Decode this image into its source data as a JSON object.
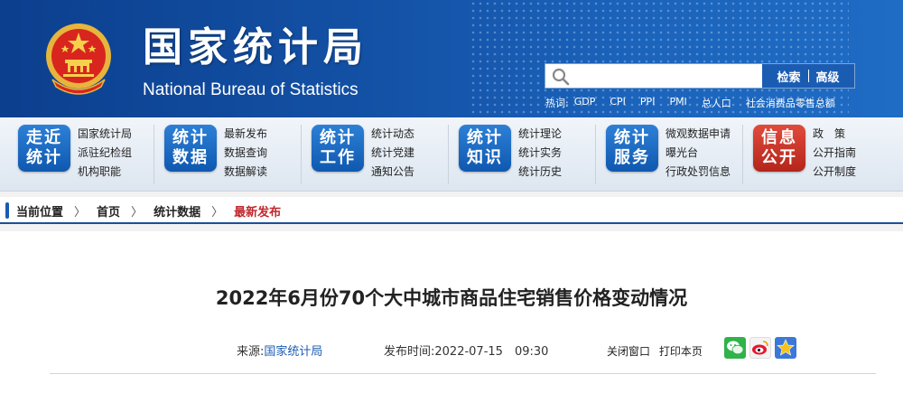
{
  "header": {
    "title_cn": "国家统计局",
    "title_en": "National Bureau of Statistics",
    "search": {
      "placeholder": "",
      "search_label": "检索",
      "advanced_label": "高级"
    },
    "hot": {
      "label": "热词:",
      "items": [
        "GDP",
        "CPI",
        "PPI",
        "PMI",
        "总人口",
        "社会消费品零售总额"
      ]
    }
  },
  "nav": [
    {
      "badge": [
        "走近",
        "统计"
      ],
      "links": [
        "国家统计局",
        "派驻纪检组",
        "机构职能"
      ]
    },
    {
      "badge": [
        "统计",
        "数据"
      ],
      "links": [
        "最新发布",
        "数据查询",
        "数据解读"
      ]
    },
    {
      "badge": [
        "统计",
        "工作"
      ],
      "links": [
        "统计动态",
        "统计党建",
        "通知公告"
      ]
    },
    {
      "badge": [
        "统计",
        "知识"
      ],
      "links": [
        "统计理论",
        "统计实务",
        "统计历史"
      ]
    },
    {
      "badge": [
        "统计",
        "服务"
      ],
      "links": [
        "微观数据申请",
        "曝光台",
        "行政处罚信息"
      ]
    },
    {
      "badge": [
        "信息",
        "公开"
      ],
      "links": [
        "政　策",
        "公开指南",
        "公开制度"
      ]
    }
  ],
  "breadcrumb": {
    "label": "当前位置",
    "items": [
      "首页",
      "统计数据",
      "最新发布"
    ]
  },
  "article": {
    "title": "2022年6月份70个大中城市商品住宅销售价格变动情况",
    "source_label": "来源:",
    "source": "国家统计局",
    "time_label": "发布时间:",
    "time": "2022-07-15　09:30",
    "close_label": "关闭窗口",
    "print_label": "打印本页"
  },
  "colors": {
    "header": "#1453a8",
    "badge_blue": "#1b5cb3",
    "badge_red": "#c0272d",
    "link": "#1b5cb3"
  }
}
